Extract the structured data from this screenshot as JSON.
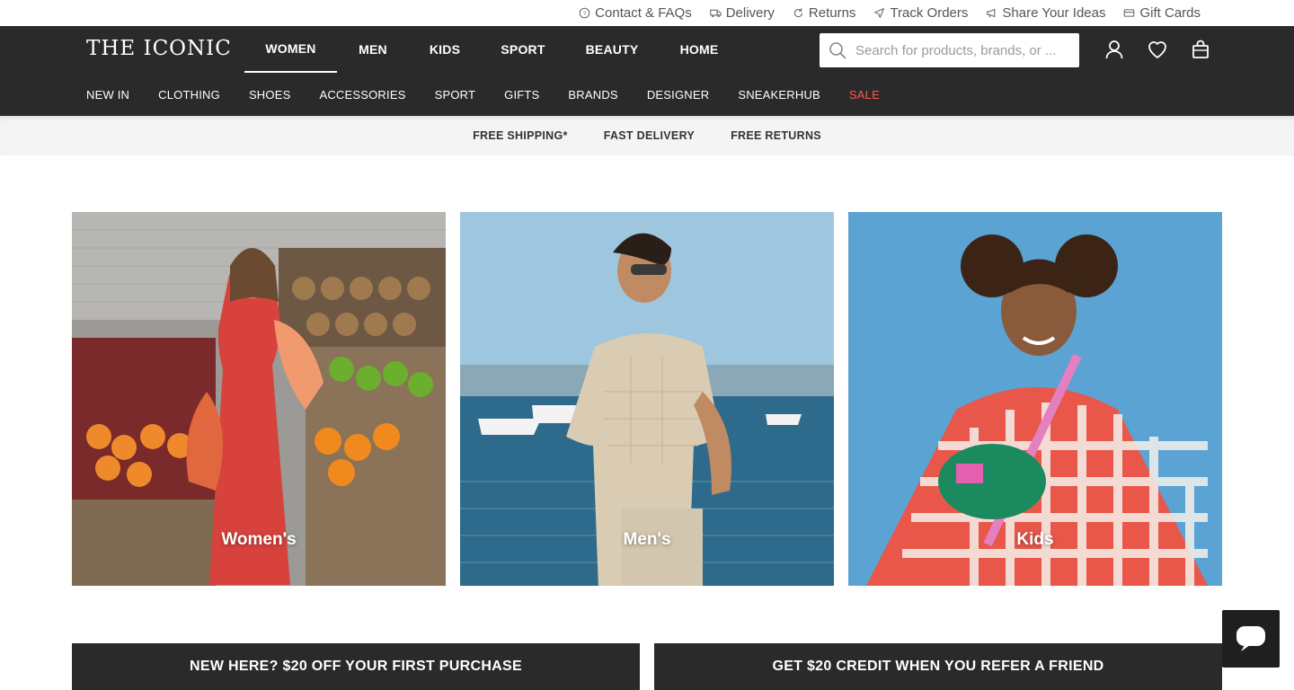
{
  "utility": {
    "links": [
      {
        "label": "Contact & FAQs",
        "icon": "help-circle-icon"
      },
      {
        "label": "Delivery",
        "icon": "truck-icon"
      },
      {
        "label": "Returns",
        "icon": "refresh-icon"
      },
      {
        "label": "Track Orders",
        "icon": "send-icon"
      },
      {
        "label": "Share Your Ideas",
        "icon": "megaphone-icon"
      },
      {
        "label": "Gift Cards",
        "icon": "gift-card-icon"
      }
    ]
  },
  "header": {
    "logo": "THE ICONIC",
    "tabs": [
      {
        "label": "WOMEN",
        "active": true
      },
      {
        "label": "MEN"
      },
      {
        "label": "KIDS"
      },
      {
        "label": "SPORT"
      },
      {
        "label": "BEAUTY"
      },
      {
        "label": "HOME"
      }
    ],
    "search": {
      "placeholder": "Search for products, brands, or ..."
    },
    "sub_nav": [
      "NEW IN",
      "CLOTHING",
      "SHOES",
      "ACCESSORIES",
      "SPORT",
      "GIFTS",
      "BRANDS",
      "DESIGNER",
      "SNEAKERHUB",
      "SALE"
    ]
  },
  "promo": [
    "FREE SHIPPING*",
    "FAST DELIVERY",
    "FREE RETURNS"
  ],
  "cards": [
    {
      "label": "Women's"
    },
    {
      "label": "Men's"
    },
    {
      "label": "Kids"
    }
  ],
  "banners": [
    "NEW HERE? $20 OFF YOUR FIRST PURCHASE",
    "GET $20 CREDIT WHEN YOU REFER A FRIEND"
  ],
  "colors": {
    "header_bg": "#2a2a2a",
    "sale": "#ff5a4f"
  }
}
